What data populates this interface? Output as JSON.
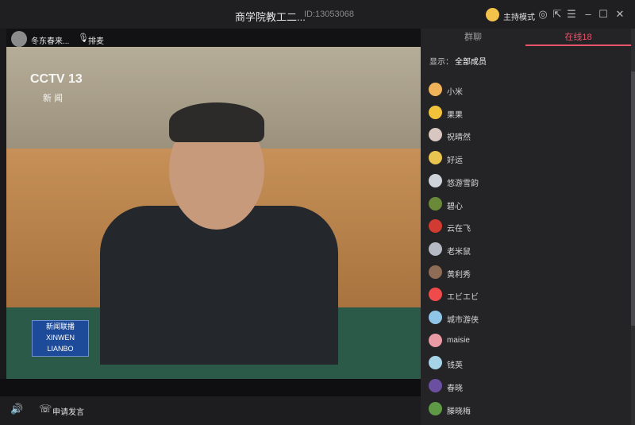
{
  "window": {
    "title": "商学院教工二...",
    "room_id": "ID:13053068",
    "host_mode": "主持模式"
  },
  "stream": {
    "presenter_name": "冬东春来...",
    "rank_label": "排麦",
    "overlay_channel": "CCTV 13",
    "overlay_sub": "新 闻",
    "logo_text": "新闻联播 XINWEN LIANBO"
  },
  "controls": {
    "apply_speak": "申请发言"
  },
  "panel": {
    "tab_chat": "群聊",
    "tab_online": "在线18",
    "filter_label": "显示：",
    "filter_value": "全部成员",
    "members": [
      {
        "name": "小米",
        "color": "#f0b35a"
      },
      {
        "name": "果果",
        "color": "#f2c23a"
      },
      {
        "name": "祝晴然",
        "color": "#d8c6c0"
      },
      {
        "name": "好运",
        "color": "#e9c44e"
      },
      {
        "name": "悠游雪韵",
        "color": "#cfd4da"
      },
      {
        "name": "碧心",
        "color": "#6a8a3a"
      },
      {
        "name": "云在飞",
        "color": "#d23b32"
      },
      {
        "name": "老米鼠",
        "color": "#b5b9c4"
      },
      {
        "name": "黄利秀",
        "color": "#8f6c55"
      },
      {
        "name": "エビエビ",
        "color": "#f04b4b"
      },
      {
        "name": "城市游侠",
        "color": "#8fc6e8"
      },
      {
        "name": "maisie",
        "color": "#e99aa5"
      },
      {
        "name": "钱英",
        "color": "#a7d3e6"
      },
      {
        "name": "春晓",
        "color": "#6b4fa0"
      },
      {
        "name": "滕晓梅",
        "color": "#5e9a45"
      }
    ]
  }
}
